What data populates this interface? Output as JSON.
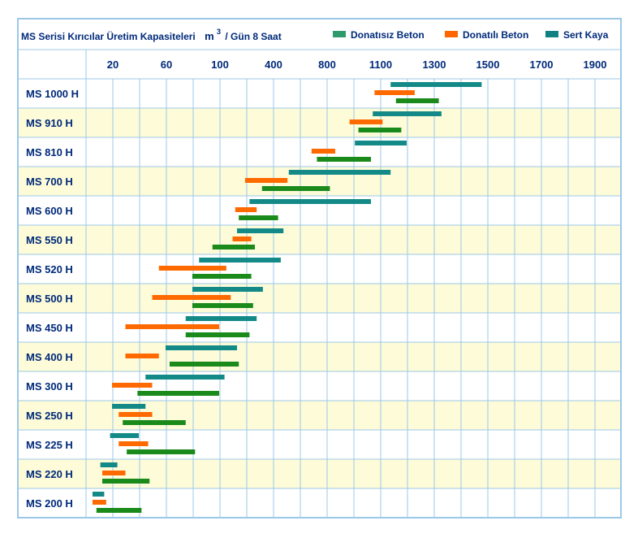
{
  "chart_data": {
    "type": "bar",
    "orientation": "horizontal-range",
    "title": "MS Serisi Kırıcılar Üretim Kapasiteleri",
    "unit_prefix": "m",
    "unit_exponent": "3",
    "unit_suffix": "/ Gün 8 Saat",
    "x_tick_labels": [
      "20",
      "60",
      "100",
      "400",
      "800",
      "1100",
      "1300",
      "1500",
      "1700",
      "1900"
    ],
    "legend": [
      {
        "name": "Donatısız Beton",
        "color": "#2e9a6e"
      },
      {
        "name": "Donatılı Beton",
        "color": "#ff6600"
      },
      {
        "name": "Sert Kaya",
        "color": "#118080"
      }
    ],
    "colors": {
      "sert_kaya": "#138a88",
      "donatili": "#ff6a00",
      "donatisiz": "#1a8a1a",
      "band": "#fdfbd8",
      "border": "#9cc8e8",
      "grid": "#9cc8e8",
      "label": "#002a7a"
    },
    "categories": [
      "MS 1000 H",
      "MS 910 H",
      "MS 810 H",
      "MS 700 H",
      "MS 600 H",
      "MS 550 H",
      "MS 520 H",
      "MS 500 H",
      "MS 450 H",
      "MS 400 H",
      "MS 300 H",
      "MS 250 H",
      "MS 225 H",
      "MS 220 H",
      "MS 200 H"
    ],
    "series": [
      {
        "name": "Sert Kaya",
        "ranges": [
          [
            1140,
            1480
          ],
          [
            1060,
            1330
          ],
          [
            960,
            1200
          ],
          [
            520,
            1140
          ],
          [
            270,
            1050
          ],
          [
            200,
            480
          ],
          [
            85,
            460
          ],
          [
            80,
            345
          ],
          [
            75,
            310
          ],
          [
            60,
            200
          ],
          [
            45,
            130
          ],
          [
            20,
            45
          ],
          [
            18,
            40
          ],
          [
            8,
            24
          ],
          [
            0,
            12
          ]
        ]
      },
      {
        "name": "Donatılı Beton",
        "ranges": [
          [
            1070,
            1230
          ],
          [
            930,
            1110
          ],
          [
            690,
            850
          ],
          [
            245,
            510
          ],
          [
            190,
            310
          ],
          [
            175,
            280
          ],
          [
            55,
            140
          ],
          [
            50,
            165
          ],
          [
            30,
            100
          ],
          [
            30,
            55
          ],
          [
            20,
            50
          ],
          [
            25,
            50
          ],
          [
            25,
            47
          ],
          [
            10,
            30
          ],
          [
            0,
            14
          ]
        ]
      },
      {
        "name": "Donatısız Beton",
        "ranges": [
          [
            1160,
            1320
          ],
          [
            980,
            1180
          ],
          [
            730,
            1050
          ],
          [
            340,
            820
          ],
          [
            210,
            440
          ],
          [
            95,
            300
          ],
          [
            80,
            280
          ],
          [
            80,
            290
          ],
          [
            75,
            270
          ],
          [
            63,
            210
          ],
          [
            39,
            100
          ],
          [
            28,
            75
          ],
          [
            31,
            82
          ],
          [
            10,
            48
          ],
          [
            4,
            42
          ]
        ]
      }
    ]
  }
}
